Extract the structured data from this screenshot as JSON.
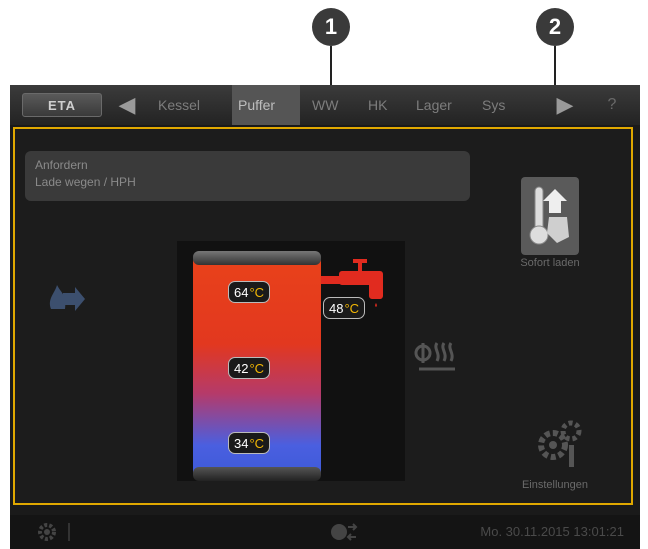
{
  "callouts": [
    "1",
    "2"
  ],
  "topbar": {
    "logo": "ETA",
    "tabs": [
      "Kessel",
      "Puffer",
      "WW",
      "HK",
      "Lager",
      "Sys"
    ],
    "active_tab": "Puffer",
    "left_arrow": "◀",
    "right_arrow": "▶",
    "help": "?"
  },
  "info": {
    "line1": "Anfordern",
    "line2": "Lade wegen / HPH"
  },
  "tank": {
    "temp_top": "64",
    "temp_mid": "42",
    "temp_bottom": "34",
    "unit": "°C"
  },
  "hot_water": {
    "temp": "48",
    "unit": "°C"
  },
  "sofort_laden": {
    "label": "Sofort laden"
  },
  "einstellungen": {
    "label": "Einstellungen"
  },
  "statusbar": {
    "datetime": "Mo. 30.11.2015 13:01:21"
  },
  "colors": {
    "accent": "#e0a800",
    "tank_hot": "#e9421a",
    "tank_cold": "#3d5ad8",
    "temp_unit": "#f2b705"
  },
  "icons": [
    "flame-arrow-icon",
    "faucet-icon",
    "heating-coil-icon",
    "thermometer-hand-icon",
    "gears-icon",
    "gear-icon",
    "globe-arrows-icon"
  ]
}
